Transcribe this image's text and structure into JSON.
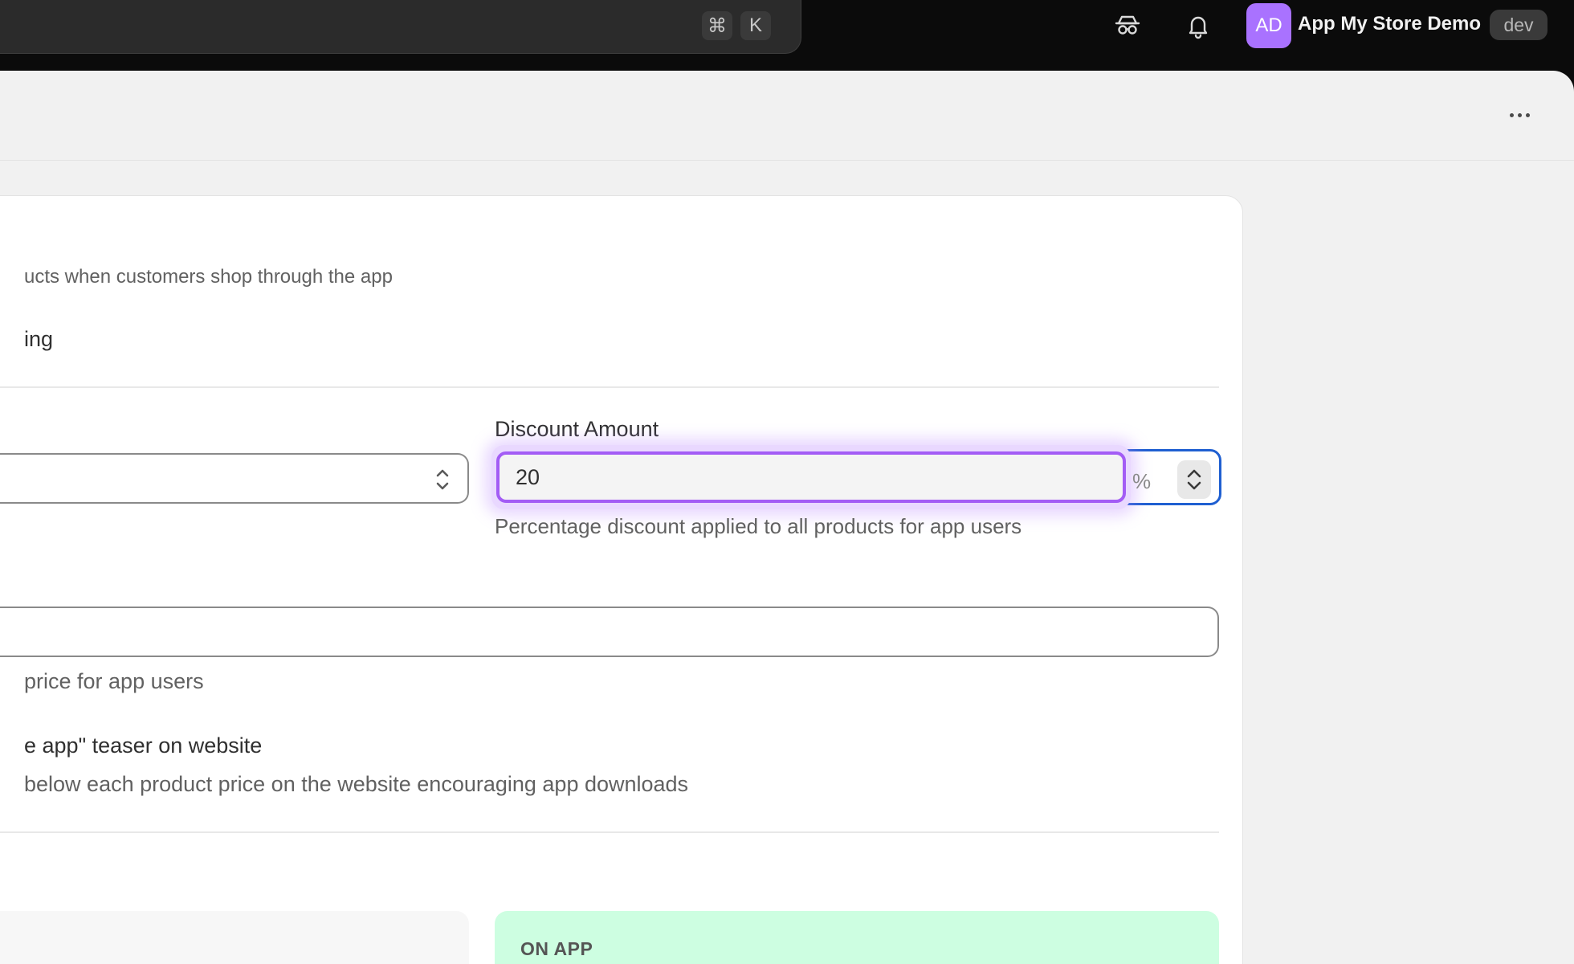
{
  "topbar": {
    "shortcut_cmd": "⌘",
    "shortcut_key": "K",
    "avatar_initials": "AD",
    "store_name": "App My Store Demo",
    "env_badge": "dev",
    "icons": [
      "incognito-icon",
      "bell-icon"
    ],
    "avatar_color": "#a972ff"
  },
  "header": {
    "more_icon": "more-horizontal-icon"
  },
  "settings": {
    "description": "ucts when customers shop through the app",
    "toggle_label": "ing",
    "discount": {
      "label": "Discount Amount",
      "value": "20",
      "suffix": "%",
      "help": "Percentage discount applied to all products for app users",
      "focus_color": "#a35cf5",
      "outer_border_color": "#1f5fd1"
    },
    "price_help": "price for app users",
    "teaser": {
      "label": "e app\" teaser on website",
      "description": "below each product price on the website encouraging app downloads"
    },
    "preview": {
      "on_app_title": "ON APP",
      "on_app_color": "#cdfee1"
    }
  }
}
